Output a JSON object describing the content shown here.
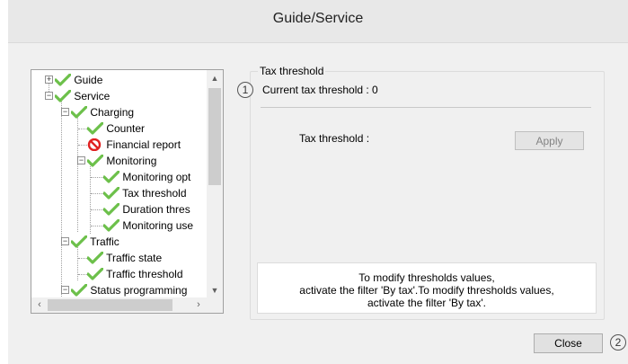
{
  "window": {
    "title": "Guide/Service"
  },
  "tree": {
    "items": [
      {
        "label": "Guide",
        "icon": "check-icon",
        "expander": "+"
      },
      {
        "label": "Service",
        "icon": "check-icon",
        "expander": "−"
      },
      {
        "label": "Charging",
        "icon": "check-icon",
        "expander": "−"
      },
      {
        "label": "Counter",
        "icon": "check-icon"
      },
      {
        "label": "Financial report",
        "icon": "forbidden-icon"
      },
      {
        "label": "Monitoring",
        "icon": "check-icon",
        "expander": "−"
      },
      {
        "label": "Monitoring opt",
        "icon": "check-icon"
      },
      {
        "label": "Tax threshold",
        "icon": "check-icon"
      },
      {
        "label": "Duration thres",
        "icon": "check-icon"
      },
      {
        "label": "Monitoring use",
        "icon": "check-icon"
      },
      {
        "label": "Traffic",
        "icon": "check-icon",
        "expander": "−"
      },
      {
        "label": "Traffic state",
        "icon": "check-icon"
      },
      {
        "label": "Traffic threshold",
        "icon": "check-icon"
      },
      {
        "label": "Status programming",
        "icon": "check-icon",
        "expander": "−"
      }
    ]
  },
  "panel": {
    "group_title": "Tax threshold",
    "badge1": "1",
    "current_threshold": "Current tax threshold : 0",
    "tax_label": "Tax threshold :",
    "apply_label": "Apply",
    "info_line1": "To modify thresholds values,",
    "info_line2": "activate the filter 'By tax'.To modify thresholds values,",
    "info_line3": "activate the filter 'By tax'."
  },
  "footer": {
    "close_label": "Close",
    "badge2": "2"
  },
  "colors": {
    "check": "#6cc04a",
    "forbidden": "#e02020"
  }
}
